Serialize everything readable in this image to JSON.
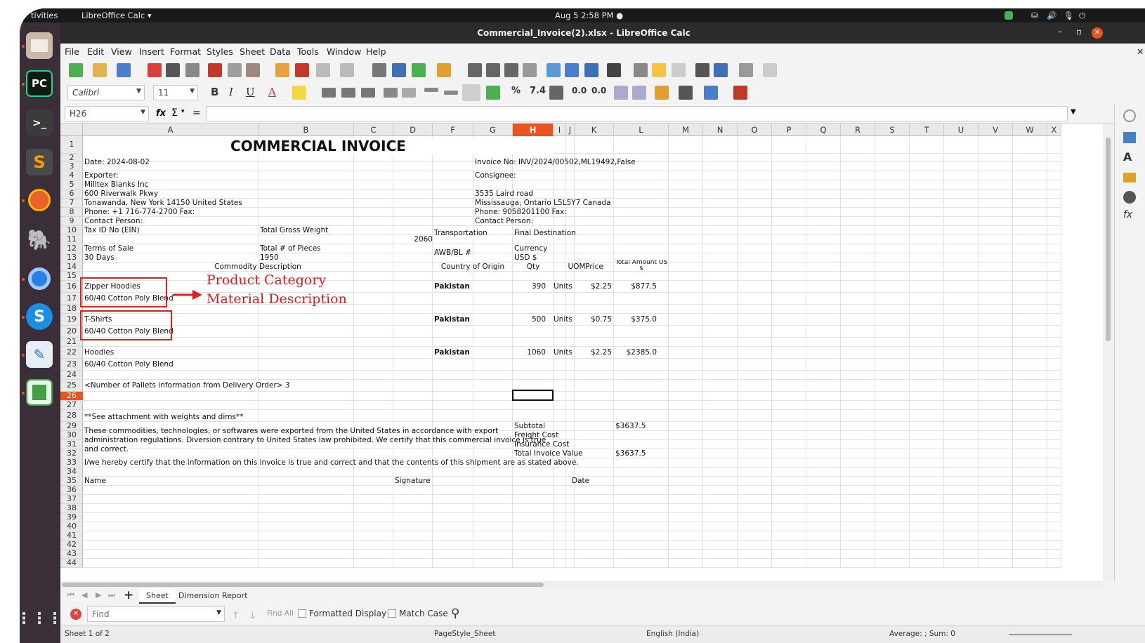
{
  "topbar": {
    "activities": "tivities",
    "app": "LibreOffice Calc ▾",
    "clock": "Aug 5  2:58 PM  ●"
  },
  "window": {
    "title": "Commercial_Invoice(2).xlsx - LibreOffice Calc"
  },
  "menu": [
    "File",
    "Edit",
    "View",
    "Insert",
    "Format",
    "Styles",
    "Sheet",
    "Data",
    "Tools",
    "Window",
    "Help"
  ],
  "toolbar": {
    "font_name": "Calibri",
    "font_size": "11"
  },
  "formula": {
    "cell_ref": "H26",
    "value": ""
  },
  "columns": [
    "A",
    "B",
    "C",
    "D",
    "F",
    "G",
    "H",
    "I",
    "J",
    "K",
    "L",
    "M",
    "N",
    "O",
    "P",
    "Q",
    "R",
    "S",
    "T",
    "U",
    "V",
    "W",
    "X"
  ],
  "rows": [
    "1",
    "2",
    "3",
    "4",
    "5",
    "6",
    "7",
    "8",
    "9",
    "10",
    "11",
    "12",
    "13",
    "14",
    "15",
    "16",
    "17",
    "18",
    "19",
    "20",
    "21",
    "22",
    "23",
    "24",
    "25",
    "26",
    "27",
    "28",
    "29",
    "30",
    "31",
    "32",
    "33",
    "34",
    "35",
    "36",
    "37",
    "38",
    "39",
    "40",
    "41",
    "42",
    "43",
    "44"
  ],
  "invoice": {
    "title": "COMMERCIAL INVOICE",
    "date": "Date: 2024-08-02",
    "invoice_no": "Invoice No: INV/2024/00502,ML19492,False",
    "exporter_label": "Exporter:",
    "exporter_name": "Milltex Blanks Inc",
    "exporter_addr1": "600 Riverwalk Pkwy",
    "exporter_addr2": "Tonawanda, New York 14150 United States",
    "exporter_phone": "Phone: +1 716-774-2700 Fax:",
    "exporter_contact": "Contact Person:",
    "consignee_label": "Consignee:",
    "consignee_addr1": "3535 Laird road",
    "consignee_addr2": "Mississauga, Ontario L5L5Y7 Canada",
    "consignee_phone": "Phone: 9058201100 Fax:",
    "consignee_contact": "Contact Person:",
    "tax_id": "Tax ID No (EIN)",
    "gross_weight_label": "Total Gross Weight",
    "gross_weight": "2060",
    "transportation": "Transportation",
    "final_destination": "Final Destination",
    "terms_label": "Terms of Sale",
    "pieces_label": "Total # of Pieces",
    "awb": "AWB/BL #",
    "currency_label": "Currency",
    "terms": "30 Days",
    "pieces": "1950",
    "currency": "USD $",
    "hdr_desc": "Commodity Description",
    "hdr_origin": "Country of Origin",
    "hdr_qty": "Qty",
    "hdr_uom": "UOM",
    "hdr_price": "Price",
    "hdr_total": "Total Amount US $",
    "items": [
      {
        "name": "Zipper Hoodies",
        "material": "60/40 Cotton Poly Blend",
        "origin": "Pakistan",
        "qty": "390",
        "uom": "Units",
        "price": "$2.25",
        "total": "$877.5"
      },
      {
        "name": "T-Shirts",
        "material": "60/40 Cotton Poly Blend",
        "origin": "Pakistan",
        "qty": "500",
        "uom": "Units",
        "price": "$0.75",
        "total": "$375.0"
      },
      {
        "name": "Hoodies",
        "material": "60/40 Cotton Poly Blend",
        "origin": "Pakistan",
        "qty": "1060",
        "uom": "Units",
        "price": "$2.25",
        "total": "$2385.0"
      }
    ],
    "pallets": "<Number of Pallets information from Delivery Order> 3",
    "attachment": "**See attachment with weights and dims**",
    "export_line1": "These commodities, technologies, or softwares were exported from the United States in accordance with export",
    "export_line2": "administration regulations. Diversion contrary to United States law prohibited. We certify that this commercial invoice is true",
    "export_line3": "and correct.",
    "subtotal_label": "Subtotal",
    "subtotal": "$3637.5",
    "freight": "Freight Cost",
    "insurance": "Insurance Cost",
    "total_label": "Total Invoice Value",
    "total": "$3637.5",
    "certify": "I/we hereby certify that the information on this invoice is true and correct and that the contents of this shipment are as stated above.",
    "name": "Name",
    "signature": "Signature",
    "date_label": "Date"
  },
  "annotations": {
    "product": "Product Category",
    "material": "Material Description"
  },
  "tabs": {
    "sheet": "Sheet",
    "dimension": "Dimension Report"
  },
  "find": {
    "placeholder": "Find",
    "find_all": "Find All",
    "formatted": "Formatted Display",
    "match_case": "Match Case"
  },
  "status": {
    "sheet": "Sheet 1 of 2",
    "pagestyle": "PageStyle_Sheet",
    "language": "English (India)",
    "sum": "Average: ; Sum: 0"
  },
  "colors": {
    "accent": "#e95420",
    "annotation": "#d81c1c"
  }
}
